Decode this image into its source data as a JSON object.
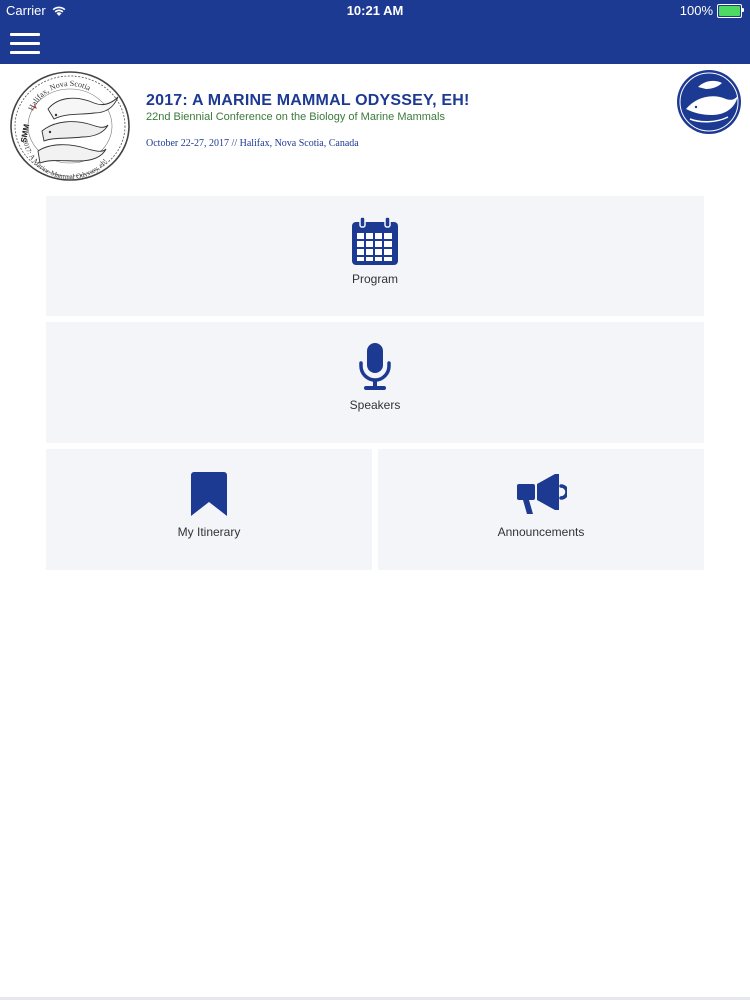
{
  "status_bar": {
    "carrier": "Carrier",
    "time": "10:21 AM",
    "battery": "100%",
    "battery_level": 1.0,
    "battery_color": "#4cd964"
  },
  "nav": {
    "menu_icon": "hamburger-menu-icon",
    "bar_color": "#1d3a93"
  },
  "header": {
    "title": "2017: A MARINE MAMMAL ODYSSEY, EH!",
    "subtitle": "22nd Biennial Conference on the Biology of Marine Mammals",
    "dates": "October 22-27, 2017 //  Halifax, Nova Scotia, Canada",
    "stamp": {
      "top_text": "Halifax, Nova Scotia",
      "bottom_text": "2017: A Marine Mammal Odyssey, eh!",
      "badge": "SMM"
    }
  },
  "tiles": [
    {
      "label": "Program",
      "icon": "calendar-icon"
    },
    {
      "label": "Speakers",
      "icon": "microphone-icon"
    },
    {
      "label": "My Itinerary",
      "icon": "bookmark-icon"
    },
    {
      "label": "Announcements",
      "icon": "megaphone-icon"
    }
  ],
  "colors": {
    "brand": "#1d3a93",
    "tile_bg": "#f3f5f9",
    "subtitle": "#3b7a3b"
  }
}
